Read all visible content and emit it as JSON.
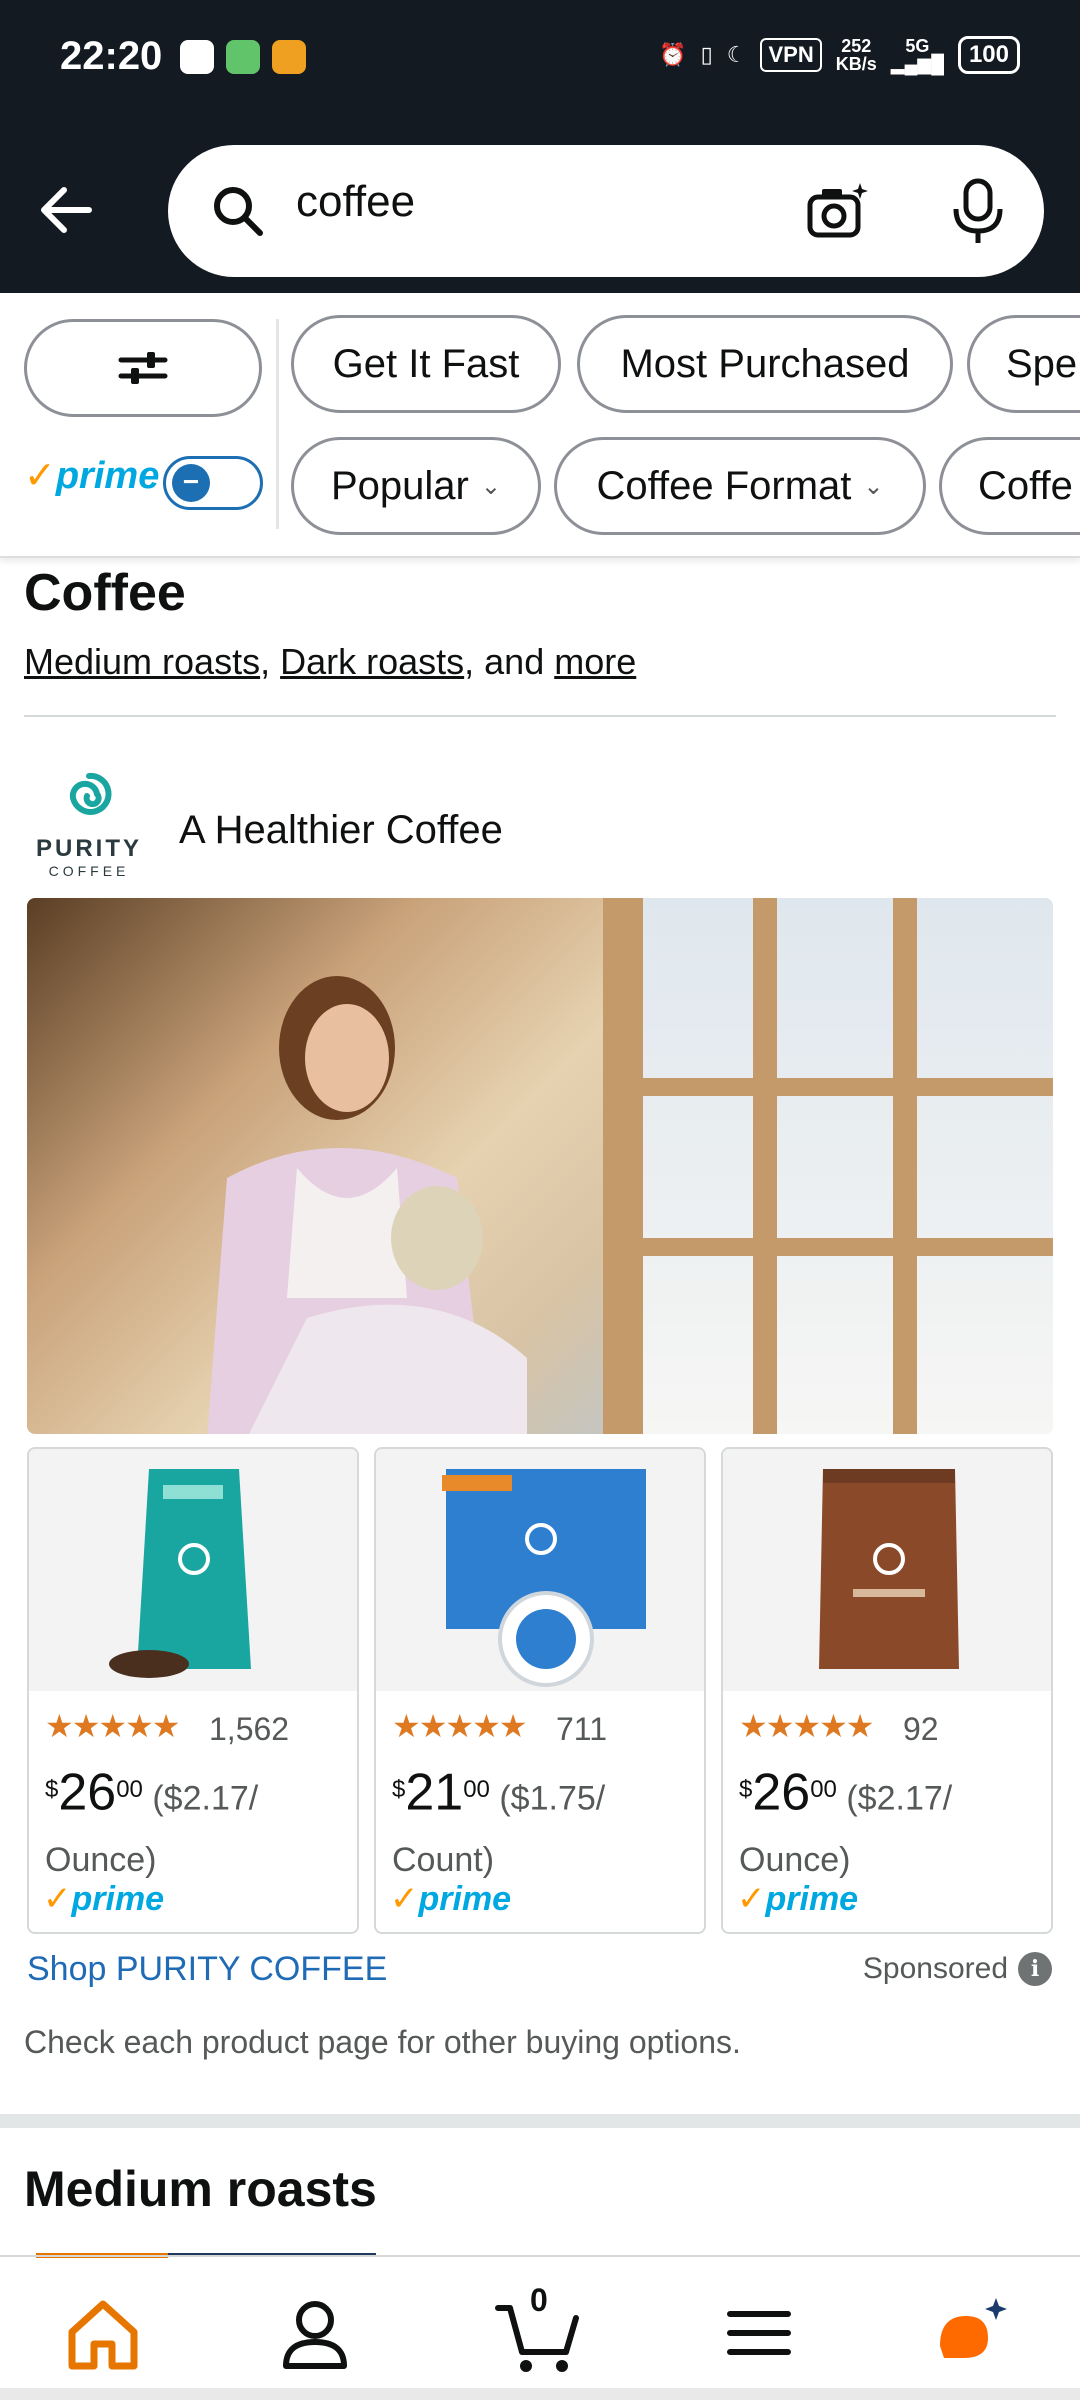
{
  "status_bar": {
    "time": "22:20",
    "vpn": "VPN",
    "speed_value": "252",
    "speed_unit": "KB/s",
    "network": "5G",
    "battery": "100"
  },
  "search": {
    "query": "coffee"
  },
  "filters": {
    "row1": [
      "Get It Fast",
      "Most Purchased",
      "Spe"
    ],
    "row2": [
      "Popular",
      "Coffee Format",
      "Coffe"
    ],
    "prime_label": "prime"
  },
  "section": {
    "title": "Coffee",
    "links": [
      "Medium roasts",
      "Dark roasts"
    ],
    "and_text": ", and ",
    "more": "more",
    "comma": ", "
  },
  "sponsored_brand": {
    "brand_name": "PURITY",
    "brand_sub": "COFFEE",
    "tagline": "A Healthier Coffee",
    "products": [
      {
        "stars": "★★★★★",
        "count": "1,562",
        "dollars": "26",
        "cents": "00",
        "unit_price": "($2.17/",
        "unit": "Ounce)",
        "prime": "prime",
        "color": "#1aa6a0"
      },
      {
        "stars": "★★★★★",
        "count": "711",
        "dollars": "21",
        "cents": "00",
        "unit_price": "($1.75/",
        "unit": "Count)",
        "prime": "prime",
        "color": "#2e7fd0"
      },
      {
        "stars": "★★★★★",
        "count": "92",
        "dollars": "26",
        "cents": "00",
        "unit_price": "($2.17/",
        "unit": "Ounce)",
        "prime": "prime",
        "color": "#8a4a2a"
      }
    ],
    "shop_link": "Shop PURITY COFFEE",
    "sponsored": "Sponsored",
    "disclaimer": "Check each product page for other buying options."
  },
  "next_section": {
    "title": "Medium roasts"
  },
  "bottom_nav": {
    "cart_count": "0",
    "icons": [
      "home-icon",
      "account-icon",
      "cart-icon",
      "menu-icon",
      "ai-assistant-icon"
    ]
  },
  "colors": {
    "header_bg": "#131a22",
    "prime_blue": "#00a8e1",
    "amazon_orange": "#ff9900",
    "link_blue": "#1f6bb5",
    "star": "#de7921"
  }
}
